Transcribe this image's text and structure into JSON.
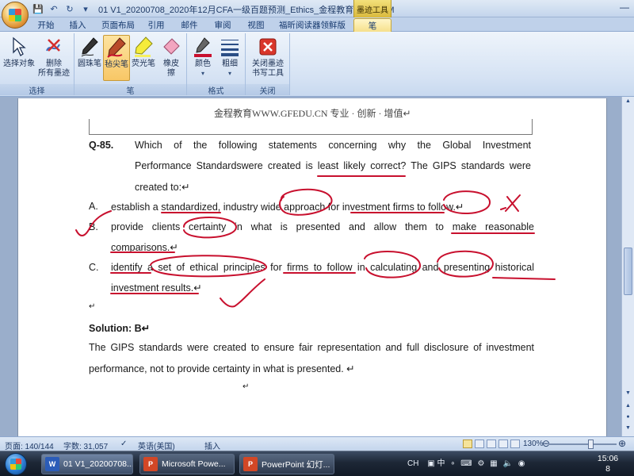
{
  "window": {
    "title": "01 V1_20200708_2020年12月CFA一级百题预测_Ethics_金程教育（授课...M",
    "context_tab_group": "墨迹工具"
  },
  "tabs": [
    "开始",
    "插入",
    "页面布局",
    "引用",
    "邮件",
    "审阅",
    "视图",
    "福昕阅读器领鲜版",
    "笔"
  ],
  "ribbon": {
    "select_group": {
      "label": "选择",
      "select_object": "选择对象",
      "delete_all_line1": "删除",
      "delete_all_line2": "所有墨迹"
    },
    "pen_group": {
      "label": "笔",
      "ballpoint": "圆珠笔",
      "felt_tip": "毡尖笔",
      "highlighter": "荧光笔",
      "eraser_line1": "橡皮",
      "eraser_line2": "擦"
    },
    "format_group": {
      "label": "格式",
      "color": "颜色",
      "thickness": "粗细"
    },
    "close_group": {
      "label": "关闭",
      "close_line1": "关闭墨迹",
      "close_line2": "书写工具"
    }
  },
  "document": {
    "header": "金程教育WWW.GFEDU.CN 专业 · 创新 · 增值↵",
    "question_number": "Q-85.",
    "question_line1": "Which of the following statements concerning why the Global Investment",
    "question_line2": "Performance Standardswere created is least likely correct? The GIPS standards were",
    "question_line3": "created to:↵",
    "options": [
      {
        "letter": "A.",
        "line1": "establish a standardized, industry wide approach for investment firms to follow.↵",
        "line2": ""
      },
      {
        "letter": "B.",
        "line1": "provide clients certainty in what is presented and allow them to make reasonable",
        "line2": "comparisons.↵"
      },
      {
        "letter": "C.",
        "line1": "identify a set of ethical principles for firms to follow in calculating and presenting historical",
        "line2": "investment results.↵"
      }
    ],
    "blank_mark": "↵",
    "solution_label": "Solution: B↵",
    "solution_line1": "The GIPS standards were created to ensure fair representation and full disclosure of investment",
    "solution_line2": "performance, not to provide certainty in what is presented.  ↵",
    "trailing_mark": "↵"
  },
  "status": {
    "page": "页面: 140/144",
    "words": "字数: 31,057",
    "language": "英语(美国)",
    "mode": "插入",
    "zoom": "130%"
  },
  "taskbar": {
    "items": [
      "01 V1_20200708...",
      "Microsoft Powe...",
      "PowerPoint 幻灯..."
    ],
    "tray_lang": "CH",
    "tray_ime": "中",
    "clock_time": "15:06",
    "clock_extra": "8"
  },
  "colors": {
    "ink": "#c8102e",
    "accent": "#f8c766",
    "ribbon": "#d6e3f4"
  }
}
